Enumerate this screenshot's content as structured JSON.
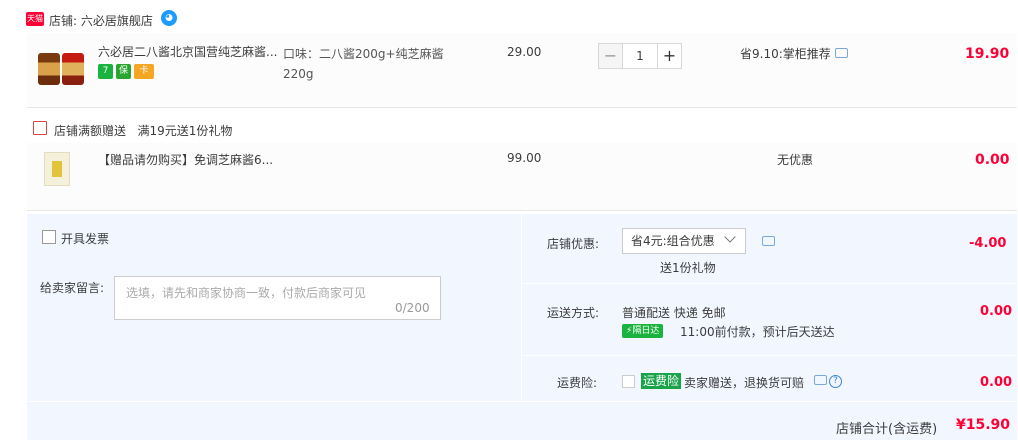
{
  "shop": {
    "badge": "天猫",
    "name": "店铺: 六必居旗舰店",
    "chat_icon": "wangwang-icon"
  },
  "item": {
    "title": "六必居二八酱北京国营纯芝麻酱...",
    "badges": [
      "7",
      "保",
      "卡"
    ],
    "sku": "口味：二八酱200g+纯芝麻酱220g",
    "price": "29.00",
    "quantity": "1",
    "saving": "省9.10:掌柜推荐",
    "subtotal": "19.90"
  },
  "gift": {
    "label": "店铺满额赠送   满19元送1份礼物",
    "title": "【赠品请勿购买】免调芝麻酱6...",
    "price": "99.00",
    "discount": "无优惠",
    "subtotal": "0.00"
  },
  "order": {
    "invoice_label": "开具发票",
    "memo_label": "给卖家留言:",
    "memo_placeholder": "选填，请先和商家协商一致，付款后商家可见",
    "memo_count": "0/200",
    "shop_discount_label": "店铺优惠:",
    "shop_discount_selected": "省4元:组合优惠",
    "shop_discount_note": "送1份礼物",
    "shop_discount_amount": "-4.00",
    "shipping_label": "运送方式:",
    "shipping_method": "普通配送 快递 免邮",
    "shipping_badge": "隔日达",
    "shipping_note": "11:00前付款，预计后天送达",
    "shipping_amount": "0.00",
    "insurance_label": "运费险:",
    "insurance_badge": "运费险",
    "insurance_text": "卖家赠送，退换货可赔",
    "insurance_amount": "0.00"
  },
  "footer": {
    "total_label": "店铺合计(含运费)",
    "total_amount": "¥15.90"
  },
  "colors": {
    "accent_price": "#ff0036",
    "panel_bg": "#f2f7ff",
    "green": "#1bb33f"
  }
}
